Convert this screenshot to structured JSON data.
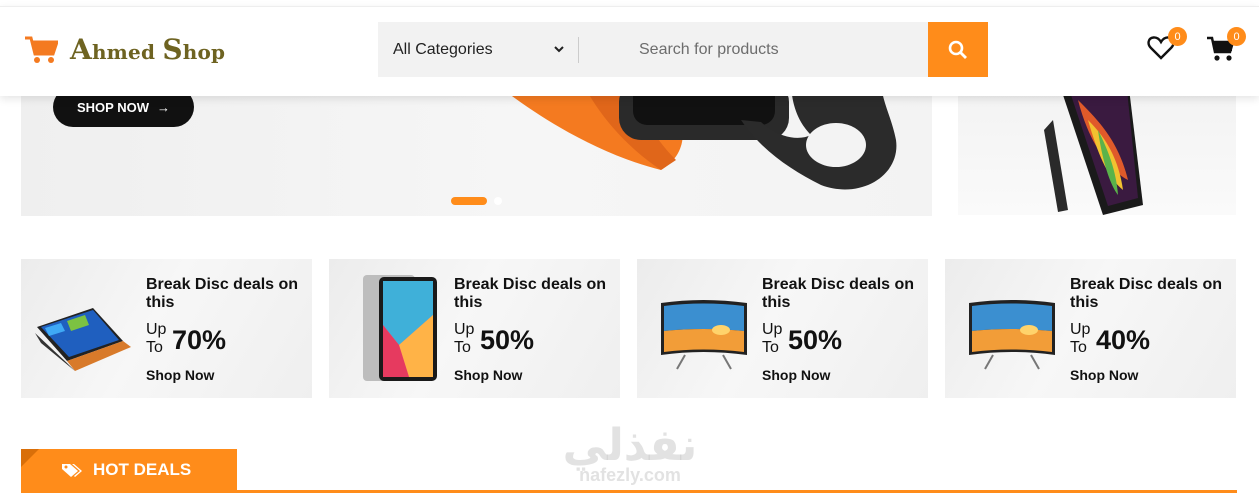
{
  "brand": {
    "name_first_initial": "A",
    "name_first_rest": "hmed",
    "name_second_initial": "S",
    "name_second_rest": "hop"
  },
  "search": {
    "category": "All Categories",
    "placeholder": "Search for products"
  },
  "header_icons": {
    "wishlist_count": "0",
    "cart_count": "0"
  },
  "hero": {
    "cta": "SHOP NOW"
  },
  "promos": [
    {
      "title": "Break Disc deals on this",
      "upto_1": "Up",
      "upto_2": "To",
      "percent": "70%",
      "link": "Shop Now",
      "image": "laptop-image"
    },
    {
      "title": "Break Disc deals on this",
      "upto_1": "Up",
      "upto_2": "To",
      "percent": "50%",
      "link": "Shop Now",
      "image": "tablet-image"
    },
    {
      "title": "Break Disc deals on this",
      "upto_1": "Up",
      "upto_2": "To",
      "percent": "50%",
      "link": "Shop Now",
      "image": "tv-image"
    },
    {
      "title": "Break Disc deals on this",
      "upto_1": "Up",
      "upto_2": "To",
      "percent": "40%",
      "link": "Shop Now",
      "image": "tv-image"
    }
  ],
  "section": {
    "hot_deals": "HOT DEALS"
  },
  "watermark": {
    "arabic": "نفذلي",
    "latin": "nafezly.com"
  },
  "colors": {
    "accent": "#ff8c1a",
    "brand_text": "#6e6321",
    "dark": "#111111"
  }
}
